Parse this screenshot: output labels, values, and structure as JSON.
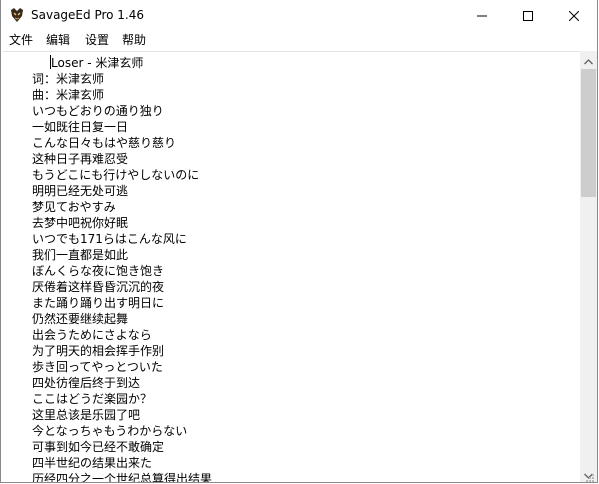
{
  "window": {
    "title": "SavageEd Pro 1.46"
  },
  "menu": {
    "items": [
      "文件",
      "编辑",
      "设置",
      "帮助"
    ]
  },
  "editor": {
    "lines": [
      "Loser - 米津玄师",
      "词：米津玄师",
      "曲：米津玄师",
      "いつもどおりの通り独り",
      "一如既往日复一日",
      "こんな日々もはや慈り慈り",
      "这种日子再难忍受",
      "もうどこにも行けやしないのに",
      "明明已经无处可逃",
      "梦见ておやすみ",
      "去梦中吧祝你好眠",
      "いつでも171らはこんな风に",
      "我们一直都是如此",
      "ぼんくらな夜に饱き饱き",
      "厌倦着这样昏昏沉沉的夜",
      "また踊り踊り出す明日に",
      "仍然还要继续起舞",
      "出会うためにさよなら",
      "为了明天的相会挥手作别",
      "歩き回ってやっとついた",
      "四处彷徨后终于到达",
      "ここはどうだ楽园か？",
      "这里总该是乐园了吧",
      "今となっちゃもうわからない",
      "可事到如今已经不敢确定",
      "四半世纪の结果出来た",
      "历经四分之一个世纪总算得出结果"
    ]
  },
  "colors": {
    "window_border": "#8a8a8a",
    "scroll_track": "#f0f0f0",
    "scroll_thumb": "#cdcdcd",
    "text": "#000000"
  },
  "icons": {
    "app": "app-logo-icon",
    "minimize": "minimize-icon",
    "maximize": "maximize-icon",
    "close": "close-icon",
    "scroll_up": "scroll-up-arrow-icon",
    "scroll_down": "scroll-down-arrow-icon",
    "resize": "resize-grip-icon"
  }
}
